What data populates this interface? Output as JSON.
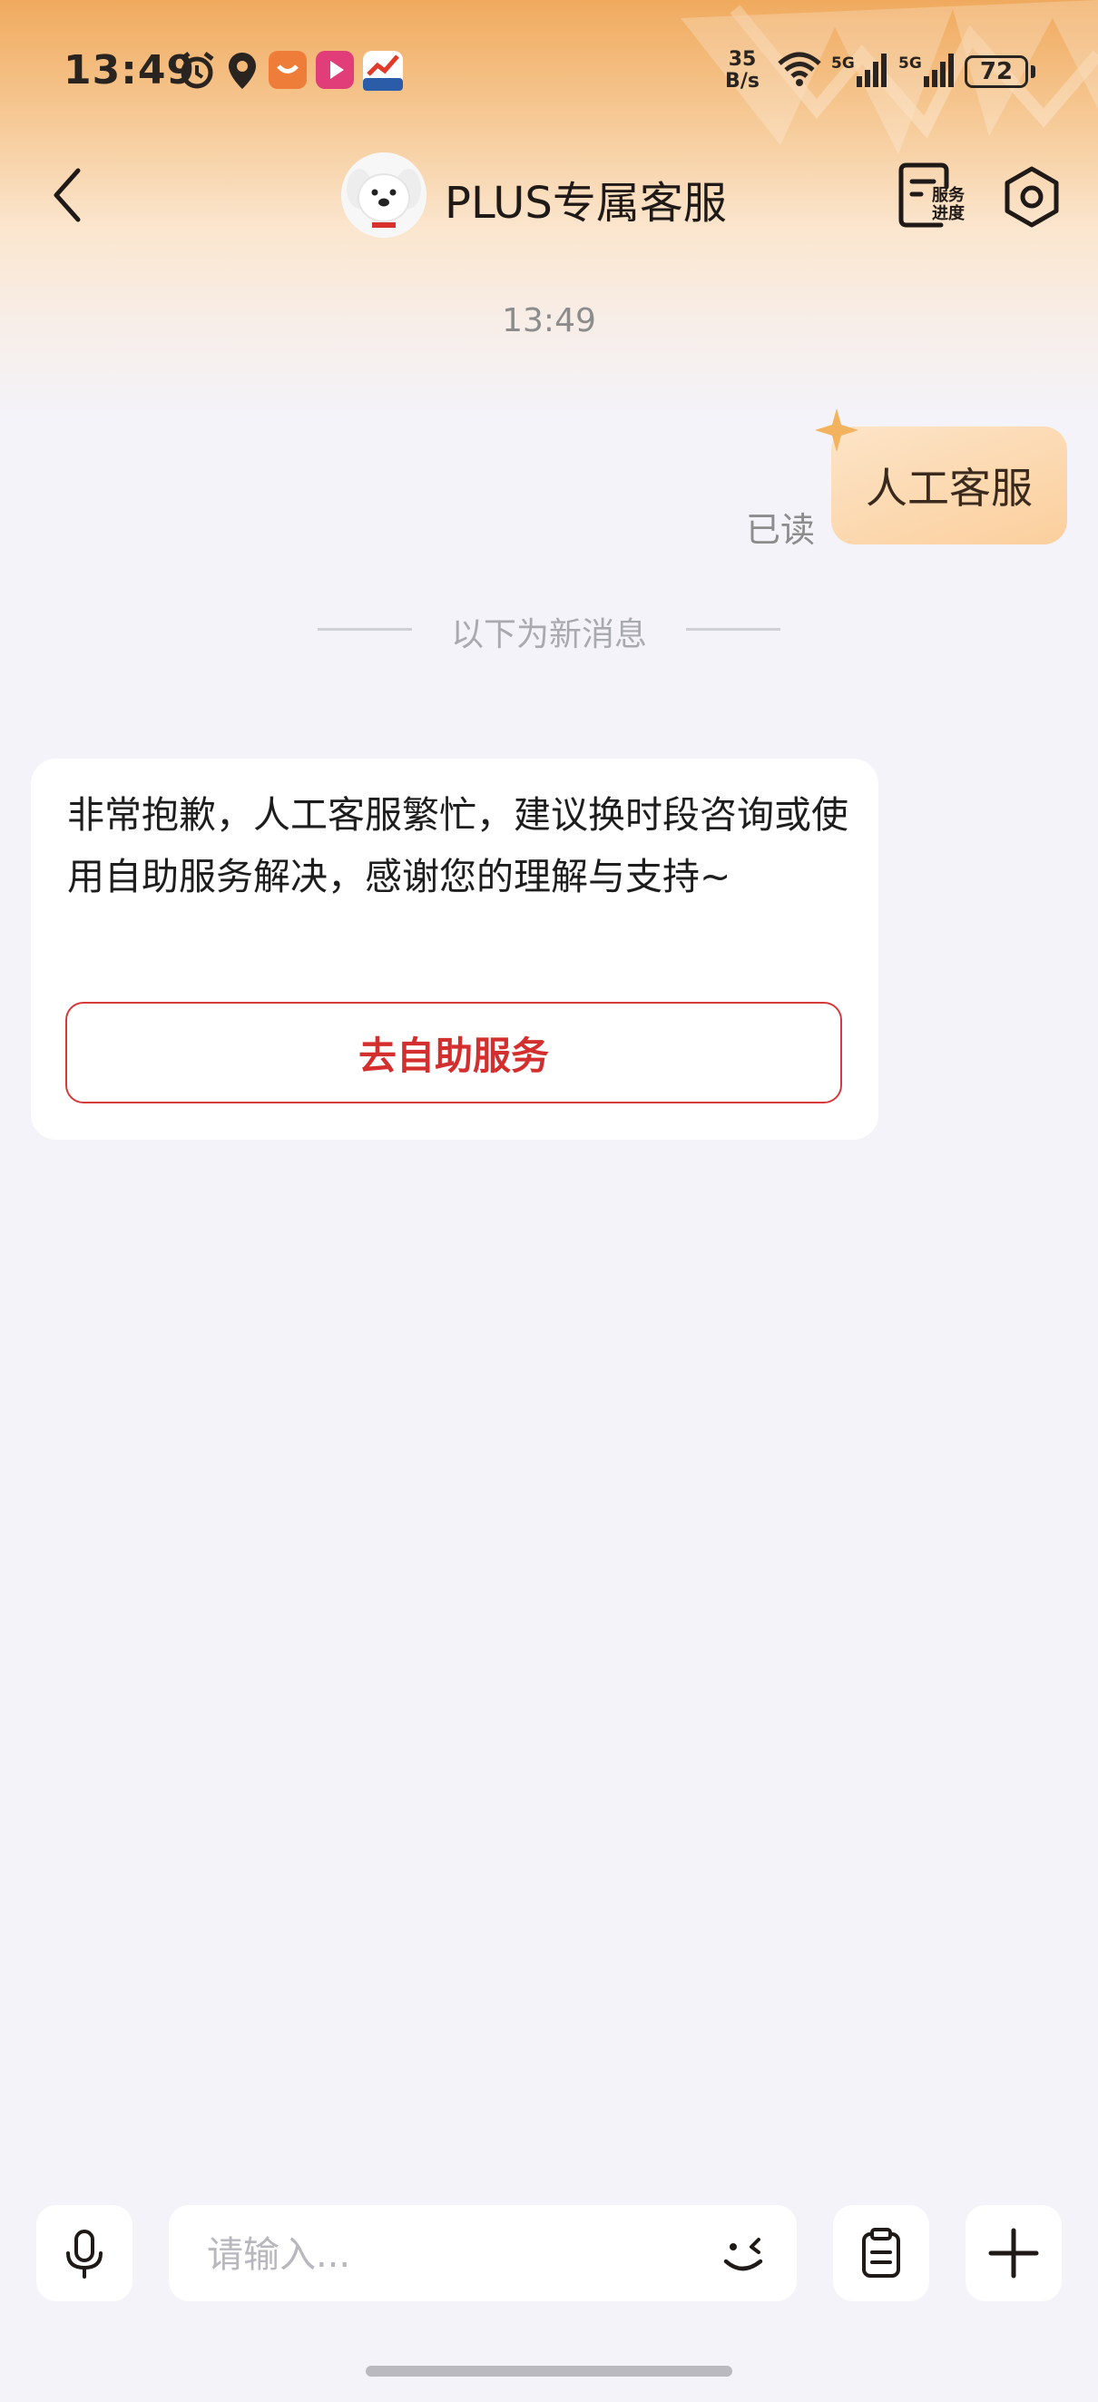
{
  "status_bar": {
    "time": "13:49",
    "net_speed_value": "35",
    "net_speed_unit": "B/s",
    "signal_1": "5G",
    "signal_2": "5G",
    "battery": "72",
    "icons": [
      "alarm-icon",
      "location-icon",
      "shopping-app-icon",
      "video-app-icon",
      "stock-app-icon",
      "wifi-icon",
      "signal-icon"
    ]
  },
  "header": {
    "title": "PLUS专属客服",
    "progress_label_line1": "服务",
    "progress_label_line2": "进度"
  },
  "chat": {
    "timestamp": "13:49",
    "outgoing": {
      "text": "人工客服",
      "read_status": "已读"
    },
    "divider": "以下为新消息",
    "incoming": {
      "text": "非常抱歉，人工客服繁忙，建议换时段咨询或使用自助服务解决，感谢您的理解与支持~",
      "button_label": "去自助服务"
    }
  },
  "input_bar": {
    "placeholder": "请输入..."
  },
  "colors": {
    "accent_red": "#d42f2f",
    "outgoing_bubble": "#fbd5a8",
    "background": "#f4f3f9"
  }
}
